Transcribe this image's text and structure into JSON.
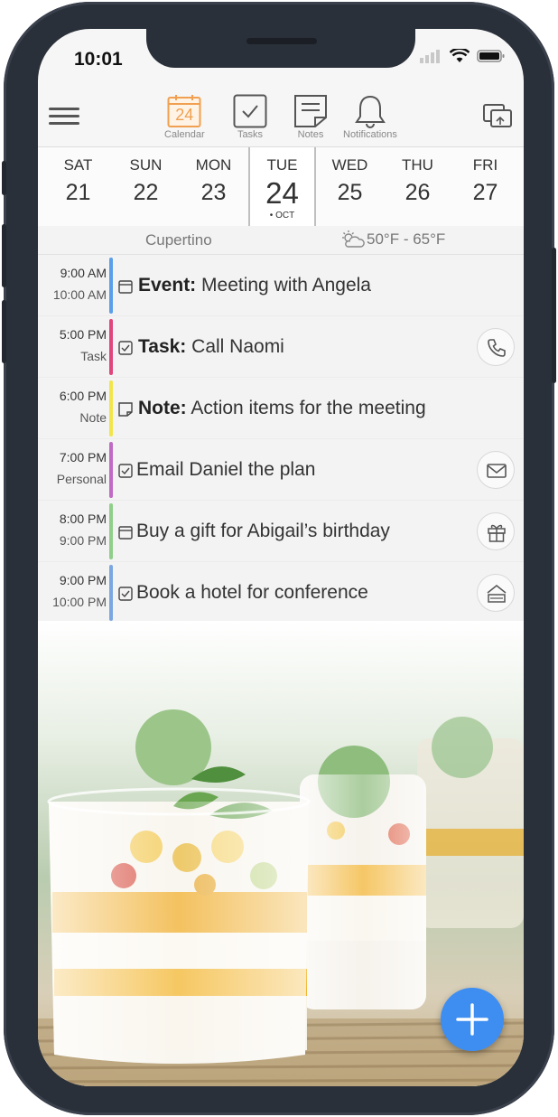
{
  "status": {
    "time": "10:01"
  },
  "toolbar": {
    "calendar_icon_text": "24",
    "items": [
      {
        "label": "Calendar",
        "icon": "calendar-icon"
      },
      {
        "label": "Tasks",
        "icon": "tasks-icon"
      },
      {
        "label": "Notes",
        "icon": "notes-icon"
      },
      {
        "label": "Notifications",
        "icon": "bell-icon"
      }
    ]
  },
  "week": {
    "days": [
      {
        "name": "SAT",
        "date": "21"
      },
      {
        "name": "SUN",
        "date": "22"
      },
      {
        "name": "MON",
        "date": "23"
      },
      {
        "name": "TUE",
        "date": "24",
        "month": "• OCT"
      },
      {
        "name": "WED",
        "date": "25"
      },
      {
        "name": "THU",
        "date": "26"
      },
      {
        "name": "FRI",
        "date": "27"
      }
    ]
  },
  "info": {
    "city": "Cupertino",
    "weather": "50°F - 65°F"
  },
  "agenda": [
    {
      "time": "9:00 AM",
      "sub": "10:00 AM",
      "kind": "Event:",
      "text": "Meeting with Angela",
      "bar": "#5b9ee9",
      "icon": "calendar-small-icon",
      "action": ""
    },
    {
      "time": "5:00 PM",
      "sub": "Task",
      "kind": "Task:",
      "text": "Call Naomi",
      "bar": "#e0457b",
      "icon": "checkbox-icon",
      "action": "phone-icon"
    },
    {
      "time": "6:00 PM",
      "sub": "Note",
      "kind": "Note:",
      "text": "Action items for the meeting",
      "bar": "#f2e54a",
      "icon": "note-small-icon",
      "action": ""
    },
    {
      "time": "7:00 PM",
      "sub": "Personal",
      "kind": "",
      "text": "Email Daniel the plan",
      "bar": "#c06ac4",
      "icon": "checkbox-icon",
      "action": "mail-icon"
    },
    {
      "time": "8:00 PM",
      "sub": "9:00 PM",
      "kind": "",
      "text": "Buy a gift for Abigail’s birthday",
      "bar": "#8fcf8a",
      "icon": "calendar-small-icon",
      "action": "gift-icon"
    },
    {
      "time": "9:00 PM",
      "sub": "10:00 PM",
      "kind": "",
      "text": "Book a hotel for conference",
      "bar": "#7ba7e0",
      "icon": "checkbox-icon",
      "action": "hotel-icon"
    }
  ],
  "colors": {
    "accent": "#3e8ef2",
    "calendar_orange": "#f0a050",
    "frame": "#2a3039"
  }
}
